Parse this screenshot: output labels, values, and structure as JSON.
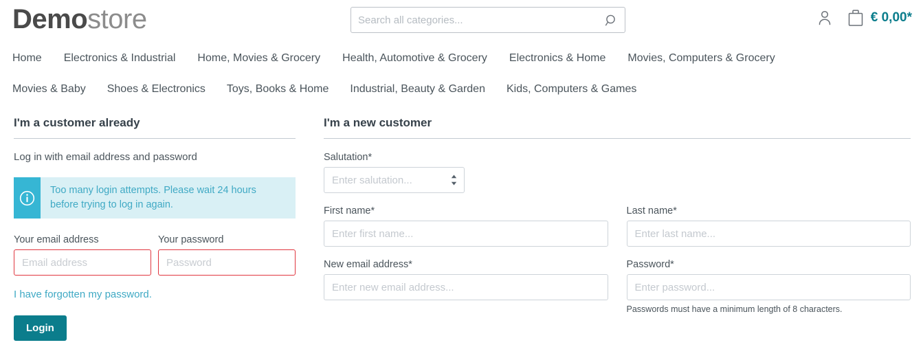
{
  "header": {
    "logo_bold": "Demo",
    "logo_light": "store",
    "search_placeholder": "Search all categories...",
    "search_value": "",
    "search_icon": "search-icon",
    "account_icon": "account-person-icon",
    "cart_icon": "shopping-bag-icon",
    "cart_total": "€ 0,00*"
  },
  "nav": {
    "row1": [
      "Home",
      "Electronics & Industrial",
      "Home, Movies & Grocery",
      "Health, Automotive & Grocery",
      "Electronics & Home",
      "Movies, Computers & Grocery"
    ],
    "row2": [
      "Movies & Baby",
      "Shoes & Electronics",
      "Toys, Books & Home",
      "Industrial, Beauty & Garden",
      "Kids, Computers & Games"
    ]
  },
  "login": {
    "title": "I'm a customer already",
    "subtitle": "Log in with email address and password",
    "alert": {
      "icon": "info-circle-icon",
      "message": "Too many login attempts. Please wait 24 hours before trying to log in again."
    },
    "email_label": "Your email address",
    "email_placeholder": "Email address",
    "email_value": "",
    "password_label": "Your password",
    "password_placeholder": "Password",
    "password_value": "",
    "forgot_link": "I have forgotten my password.",
    "submit_label": "Login"
  },
  "register": {
    "title": "I'm a new customer",
    "salutation_label": "Salutation*",
    "salutation_placeholder": "Enter salutation...",
    "salutation_value": "Enter salutation...",
    "first_name_label": "First name*",
    "first_name_placeholder": "Enter first name...",
    "first_name_value": "",
    "last_name_label": "Last name*",
    "last_name_placeholder": "Enter last name...",
    "last_name_value": "",
    "new_email_label": "New email address*",
    "new_email_placeholder": "Enter new email address...",
    "new_email_value": "",
    "password_label": "Password*",
    "password_placeholder": "Enter password...",
    "password_value": "",
    "password_help": "Passwords must have a minimum length of 8 characters."
  },
  "colors": {
    "brand_teal": "#0b7d8c",
    "accent_cyan": "#36b6d4",
    "alert_bg": "#d9f0f5",
    "alert_text": "#3fa9c4",
    "error_border": "#e0353e",
    "text": "#4a545b"
  }
}
